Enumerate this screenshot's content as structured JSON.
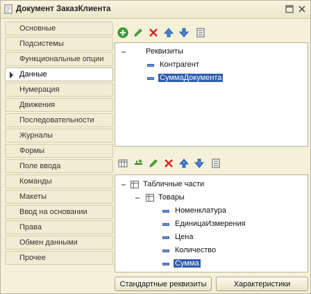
{
  "window": {
    "title": "Документ ЗаказКлиента"
  },
  "sidebar": {
    "items": [
      {
        "label": "Основные",
        "active": false
      },
      {
        "label": "Подсистемы",
        "active": false
      },
      {
        "label": "Функциональные опции",
        "active": false
      },
      {
        "label": "Данные",
        "active": true
      },
      {
        "label": "Нумерация",
        "active": false
      },
      {
        "label": "Движения",
        "active": false
      },
      {
        "label": "Последовательности",
        "active": false
      },
      {
        "label": "Журналы",
        "active": false
      },
      {
        "label": "Формы",
        "active": false
      },
      {
        "label": "Поле ввода",
        "active": false
      },
      {
        "label": "Команды",
        "active": false
      },
      {
        "label": "Макеты",
        "active": false
      },
      {
        "label": "Ввод на основании",
        "active": false
      },
      {
        "label": "Права",
        "active": false
      },
      {
        "label": "Обмен данными",
        "active": false
      },
      {
        "label": "Прочее",
        "active": false
      }
    ]
  },
  "top_toolbar": {
    "icons": [
      "add-icon",
      "edit-icon",
      "delete-icon",
      "move-up-icon",
      "move-down-icon",
      "sort-icon"
    ]
  },
  "attributes_tree": {
    "root": "Реквизиты",
    "items": [
      {
        "label": "Контрагент",
        "selected": false
      },
      {
        "label": "СуммаДокумента",
        "selected": true
      }
    ]
  },
  "bottom_toolbar": {
    "icons": [
      "add-table-icon",
      "add-column-icon",
      "edit-icon",
      "delete-icon",
      "move-up-icon",
      "move-down-icon",
      "sort-icon"
    ]
  },
  "tables_tree": {
    "root": "Табличные части",
    "table": "Товары",
    "items": [
      {
        "label": "Номенклатура",
        "selected": false
      },
      {
        "label": "ЕдиницаИзмерения",
        "selected": false
      },
      {
        "label": "Цена",
        "selected": false
      },
      {
        "label": "Количество",
        "selected": false
      },
      {
        "label": "Сумма",
        "selected": true
      }
    ]
  },
  "buttons": {
    "standard_attributes": "Стандартные реквизиты",
    "characteristics": "Характеристики"
  }
}
